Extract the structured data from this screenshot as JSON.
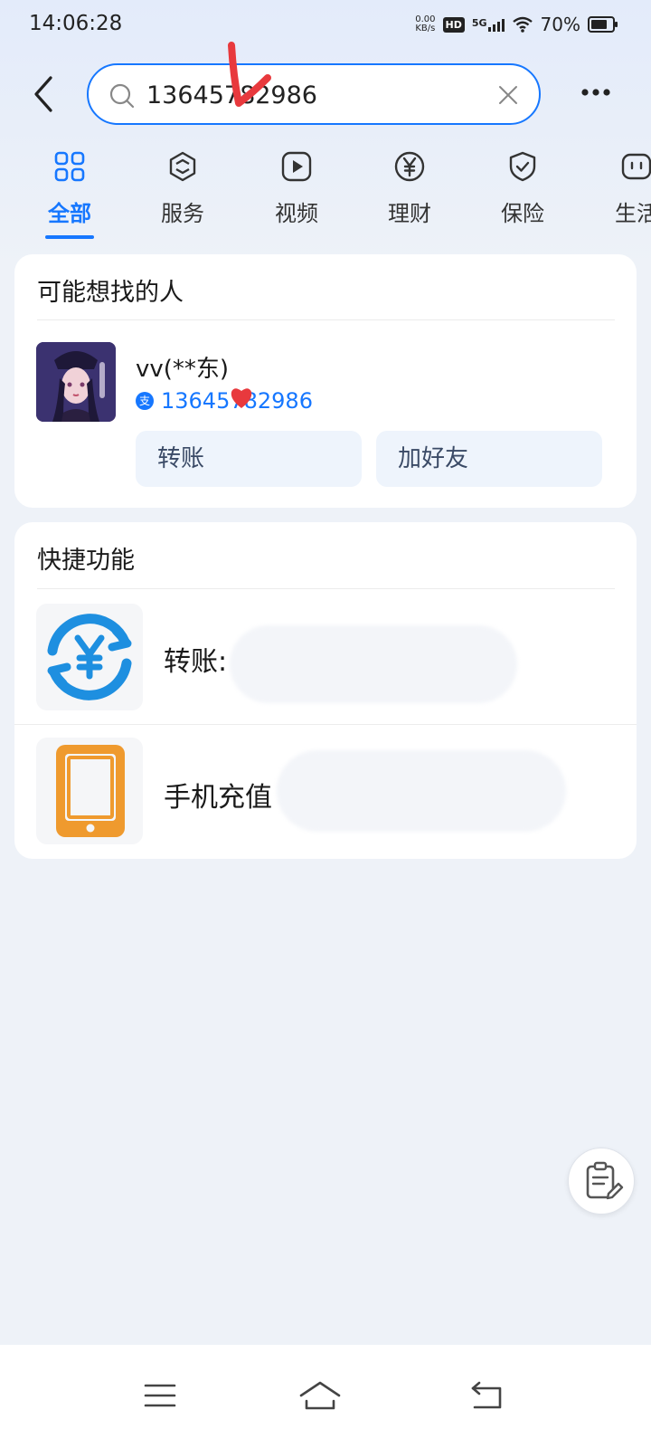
{
  "status_bar": {
    "time": "14:06:28",
    "speed_value": "0.00",
    "speed_unit": "KB/s",
    "hd": "HD",
    "network": "5G",
    "battery": "70%"
  },
  "search": {
    "query": "13645782986"
  },
  "tabs": [
    {
      "label": "全部",
      "icon": "grid-icon",
      "active": true
    },
    {
      "label": "服务",
      "icon": "service-cube-icon",
      "active": false
    },
    {
      "label": "视频",
      "icon": "play-icon",
      "active": false
    },
    {
      "label": "理财",
      "icon": "yen-icon",
      "active": false
    },
    {
      "label": "保险",
      "icon": "shield-check-icon",
      "active": false
    },
    {
      "label": "生活",
      "icon": "life-icon",
      "active": false
    }
  ],
  "people_section": {
    "title": "可能想找的人",
    "person": {
      "name": "vv(**东)",
      "phone": "13645782986",
      "transfer_button": "转账",
      "add_friend_button": "加好友"
    }
  },
  "quick_section": {
    "title": "快捷功能",
    "items": [
      {
        "label": "转账:",
        "icon": "yen-circle-arrows-icon"
      },
      {
        "label": "手机充值",
        "icon": "phone-recharge-icon"
      }
    ]
  },
  "colors": {
    "accent": "#1677ff",
    "background": "#eef2f8",
    "annotation": "#e8393d"
  }
}
